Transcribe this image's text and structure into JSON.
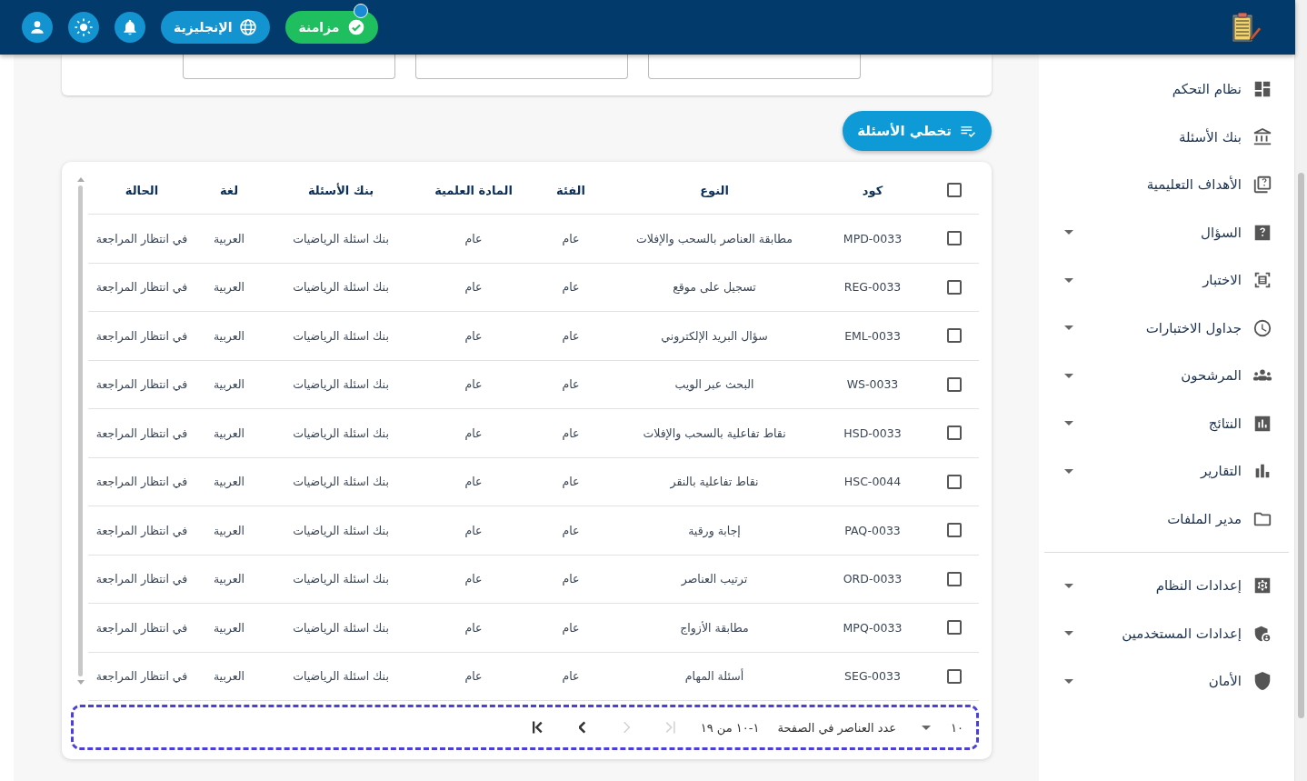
{
  "header": {
    "sync_label": "مزامنة",
    "language_label": "الإنجليزية"
  },
  "sidebar": {
    "sections": [
      {
        "items": [
          {
            "label": "نظام التحكم",
            "kind": "link"
          },
          {
            "label": "بنك الأسئلة",
            "kind": "link"
          },
          {
            "label": "الأهداف التعليمية",
            "kind": "link"
          },
          {
            "label": "السؤال",
            "kind": "group"
          },
          {
            "label": "الاختبار",
            "kind": "group"
          },
          {
            "label": "جداول الاختبارات",
            "kind": "group"
          },
          {
            "label": "المرشحون",
            "kind": "group"
          },
          {
            "label": "النتائج",
            "kind": "group"
          },
          {
            "label": "التقارير",
            "kind": "group"
          },
          {
            "label": "مدير الملفات",
            "kind": "link"
          }
        ]
      },
      {
        "items": [
          {
            "label": "إعدادات النظام",
            "kind": "group"
          },
          {
            "label": "إعدادات المستخدمين",
            "kind": "group"
          },
          {
            "label": "الأمان",
            "kind": "group"
          }
        ]
      }
    ]
  },
  "skip_button": {
    "label": "تخطي الأسئلة"
  },
  "table": {
    "select_all": {
      "checked": false
    },
    "columns": [
      "كود",
      "النوع",
      "الفئة",
      "المادة العلمية",
      "بنك الأسئلة",
      "لغة",
      "الحالة"
    ],
    "rows": [
      {
        "selected": false,
        "cells": [
          "MPD-0033",
          "مطابقة العناصر بالسحب والإفلات",
          "عام",
          "عام",
          "بنك اسئلة الرياضيات",
          "العربية",
          "في انتظار المراجعة"
        ]
      },
      {
        "selected": false,
        "cells": [
          "REG-0033",
          "تسجيل على موقع",
          "عام",
          "عام",
          "بنك اسئلة الرياضيات",
          "العربية",
          "في انتظار المراجعة"
        ]
      },
      {
        "selected": false,
        "cells": [
          "EML-0033",
          "سؤال البريد الإلكتروني",
          "عام",
          "عام",
          "بنك اسئلة الرياضيات",
          "العربية",
          "في انتظار المراجعة"
        ]
      },
      {
        "selected": false,
        "cells": [
          "WS-0033",
          "البحث عبر الويب",
          "عام",
          "عام",
          "بنك اسئلة الرياضيات",
          "العربية",
          "في انتظار المراجعة"
        ]
      },
      {
        "selected": false,
        "cells": [
          "HSD-0033",
          "نقاط تفاعلية بالسحب والإفلات",
          "عام",
          "عام",
          "بنك اسئلة الرياضيات",
          "العربية",
          "في انتظار المراجعة"
        ]
      },
      {
        "selected": false,
        "cells": [
          "HSC-0044",
          "نقاط تفاعلية بالنقر",
          "عام",
          "عام",
          "بنك اسئلة الرياضيات",
          "العربية",
          "في انتظار المراجعة"
        ]
      },
      {
        "selected": false,
        "cells": [
          "PAQ-0033",
          "إجابة ورقية",
          "عام",
          "عام",
          "بنك اسئلة الرياضيات",
          "العربية",
          "في انتظار المراجعة"
        ]
      },
      {
        "selected": false,
        "cells": [
          "ORD-0033",
          "ترتيب العناصر",
          "عام",
          "عام",
          "بنك اسئلة الرياضيات",
          "العربية",
          "في انتظار المراجعة"
        ]
      },
      {
        "selected": false,
        "cells": [
          "MPQ-0033",
          "مطابقة الأزواج",
          "عام",
          "عام",
          "بنك اسئلة الرياضيات",
          "العربية",
          "في انتظار المراجعة"
        ]
      },
      {
        "selected": false,
        "cells": [
          "SEG-0033",
          "أسئلة المهام",
          "عام",
          "عام",
          "بنك اسئلة الرياضيات",
          "العربية",
          "في انتظار المراجعة"
        ]
      }
    ]
  },
  "pagination": {
    "page_size": "١٠",
    "page_size_label": "عدد العناصر في الصفحة",
    "range": "١-١٠ من ١٩",
    "buttons": [
      {
        "kind": "first",
        "disabled": true
      },
      {
        "kind": "previous",
        "disabled": true
      },
      {
        "kind": "next",
        "disabled": false
      },
      {
        "kind": "last",
        "disabled": false
      }
    ]
  }
}
